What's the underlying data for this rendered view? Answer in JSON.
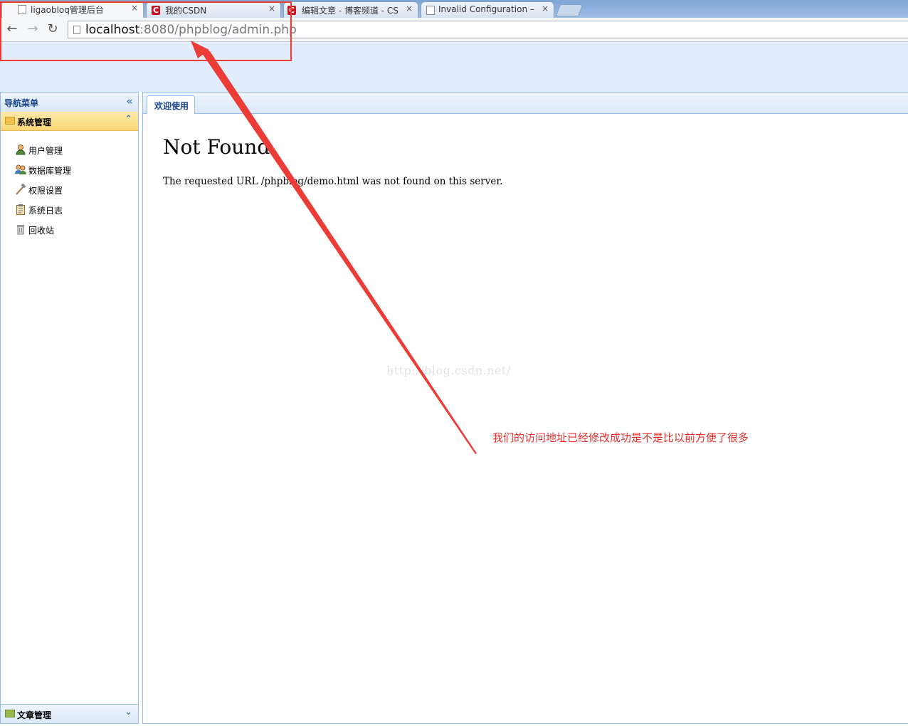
{
  "browser": {
    "tabs": [
      {
        "title": "ligaobloq管理后台",
        "icon": "page-icon",
        "active": true
      },
      {
        "title": "我的CSDN",
        "icon": "csdn-icon",
        "active": false
      },
      {
        "title": "编辑文章 - 博客频道 - CS",
        "icon": "csdn-icon",
        "active": false
      },
      {
        "title": "Invalid Configuration – ",
        "icon": "page-icon",
        "active": false
      }
    ],
    "close_glyph": "×",
    "csdn_letter": "C",
    "url_host": "localhost",
    "url_rest": ":8080/phpblog/admin.php"
  },
  "sidebar": {
    "title": "导航菜单",
    "group_open": {
      "label": "系统管理",
      "icon": "folder-icon"
    },
    "items": [
      {
        "label": "用户管理",
        "icon": "user-icon"
      },
      {
        "label": "数据库管理",
        "icon": "database-users-icon"
      },
      {
        "label": "权限设置",
        "icon": "hammer-icon"
      },
      {
        "label": "系统日志",
        "icon": "clipboard-icon"
      },
      {
        "label": "回收站",
        "icon": "trash-icon"
      }
    ],
    "group_closed": {
      "label": "文章管理",
      "icon": "book-icon"
    }
  },
  "main": {
    "tab_label": "欢迎使用",
    "error_title": "Not Found",
    "error_message": "The requested URL /phpblog/demo.html was not found on this server."
  },
  "overlay": {
    "watermark": "http://blog.csdn.net/",
    "annotation": "我们的访问地址已经修改成功是不是比以前方便了很多",
    "annotation_color": "#e8302c"
  }
}
